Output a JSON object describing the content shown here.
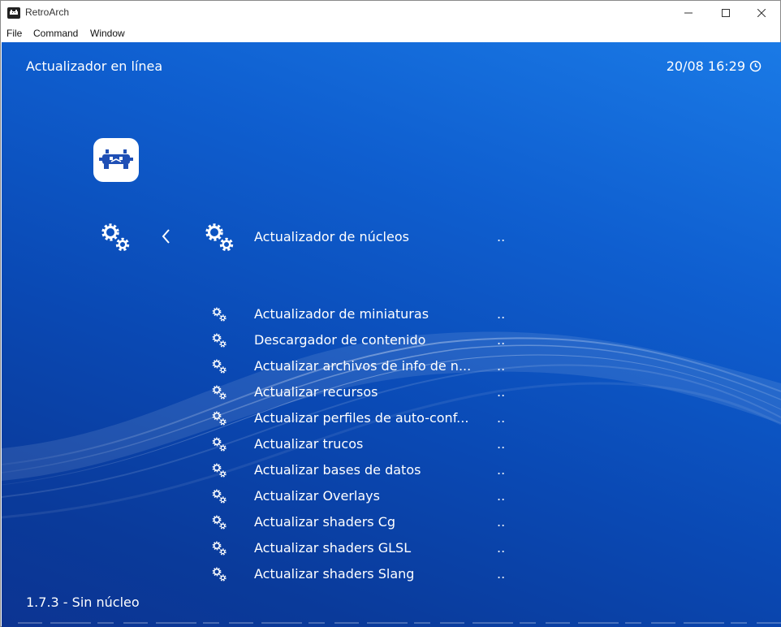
{
  "window": {
    "title": "RetroArch"
  },
  "menubar": {
    "items": [
      "File",
      "Command",
      "Window"
    ]
  },
  "header": {
    "title": "Actualizador en línea",
    "clock": "20/08 16:29"
  },
  "icons": {
    "app": "retroarch-icon",
    "logo": "retroarch-logo-icon",
    "settings": "gears-icon",
    "back": "chevron-left-icon",
    "clock": "clock-icon"
  },
  "menu": {
    "selected": {
      "label": "Actualizador de núcleos",
      "value": ".."
    },
    "items": [
      {
        "label": "Actualizador de miniaturas",
        "value": ".."
      },
      {
        "label": "Descargador de contenido",
        "value": ".."
      },
      {
        "label": "Actualizar archivos de info de n...",
        "value": ".."
      },
      {
        "label": "Actualizar recursos",
        "value": ".."
      },
      {
        "label": "Actualizar perfiles de auto-conf...",
        "value": ".."
      },
      {
        "label": "Actualizar trucos",
        "value": ".."
      },
      {
        "label": "Actualizar bases de datos",
        "value": ".."
      },
      {
        "label": "Actualizar Overlays",
        "value": ".."
      },
      {
        "label": "Actualizar shaders Cg",
        "value": ".."
      },
      {
        "label": "Actualizar shaders GLSL",
        "value": ".."
      },
      {
        "label": "Actualizar shaders Slang",
        "value": ".."
      }
    ]
  },
  "footer": {
    "version": "1.7.3 - Sin núcleo"
  },
  "colors": {
    "background_top": "#1a7ae6",
    "background_bottom": "#0c3492",
    "text": "#ffffff",
    "logo_blue": "#1f4fb5"
  }
}
